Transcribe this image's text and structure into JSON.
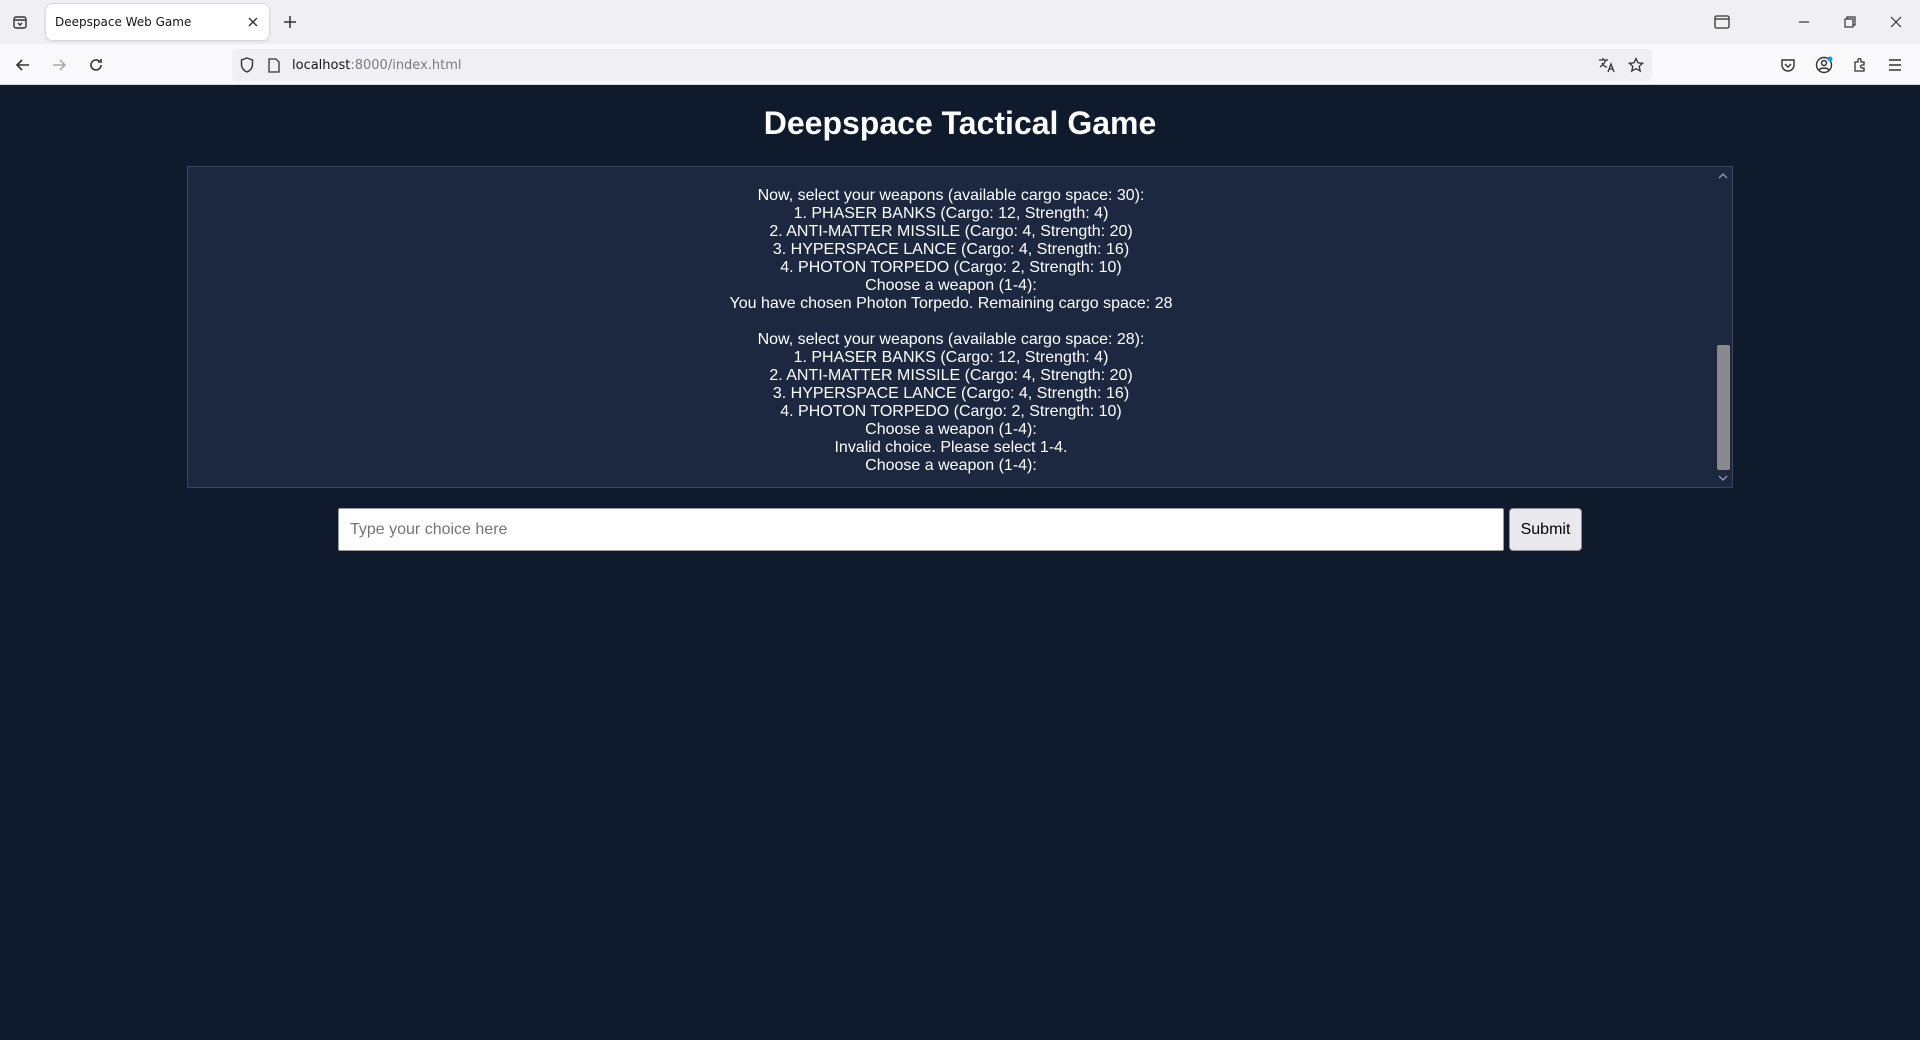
{
  "browser": {
    "tab_title": "Deepspace Web Game",
    "url_host": "localhost",
    "url_rest": ":8000/index.html"
  },
  "page": {
    "title": "Deepspace Tactical Game",
    "log_block_1": [
      "Now, select your weapons (available cargo space: 30):",
      "1. PHASER BANKS (Cargo: 12, Strength: 4)",
      "2. ANTI-MATTER MISSILE (Cargo: 4, Strength: 20)",
      "3. HYPERSPACE LANCE (Cargo: 4, Strength: 16)",
      "4. PHOTON TORPEDO (Cargo: 2, Strength: 10)",
      "Choose a weapon (1-4):",
      "You have chosen Photon Torpedo. Remaining cargo space: 28"
    ],
    "log_block_2": [
      "Now, select your weapons (available cargo space: 28):",
      "1. PHASER BANKS (Cargo: 12, Strength: 4)",
      "2. ANTI-MATTER MISSILE (Cargo: 4, Strength: 20)",
      "3. HYPERSPACE LANCE (Cargo: 4, Strength: 16)",
      "4. PHOTON TORPEDO (Cargo: 2, Strength: 10)",
      "Choose a weapon (1-4):",
      "Invalid choice. Please select 1-4.",
      "Choose a weapon (1-4):"
    ],
    "input_placeholder": "Type your choice here",
    "input_value": "",
    "submit_label": "Submit"
  }
}
